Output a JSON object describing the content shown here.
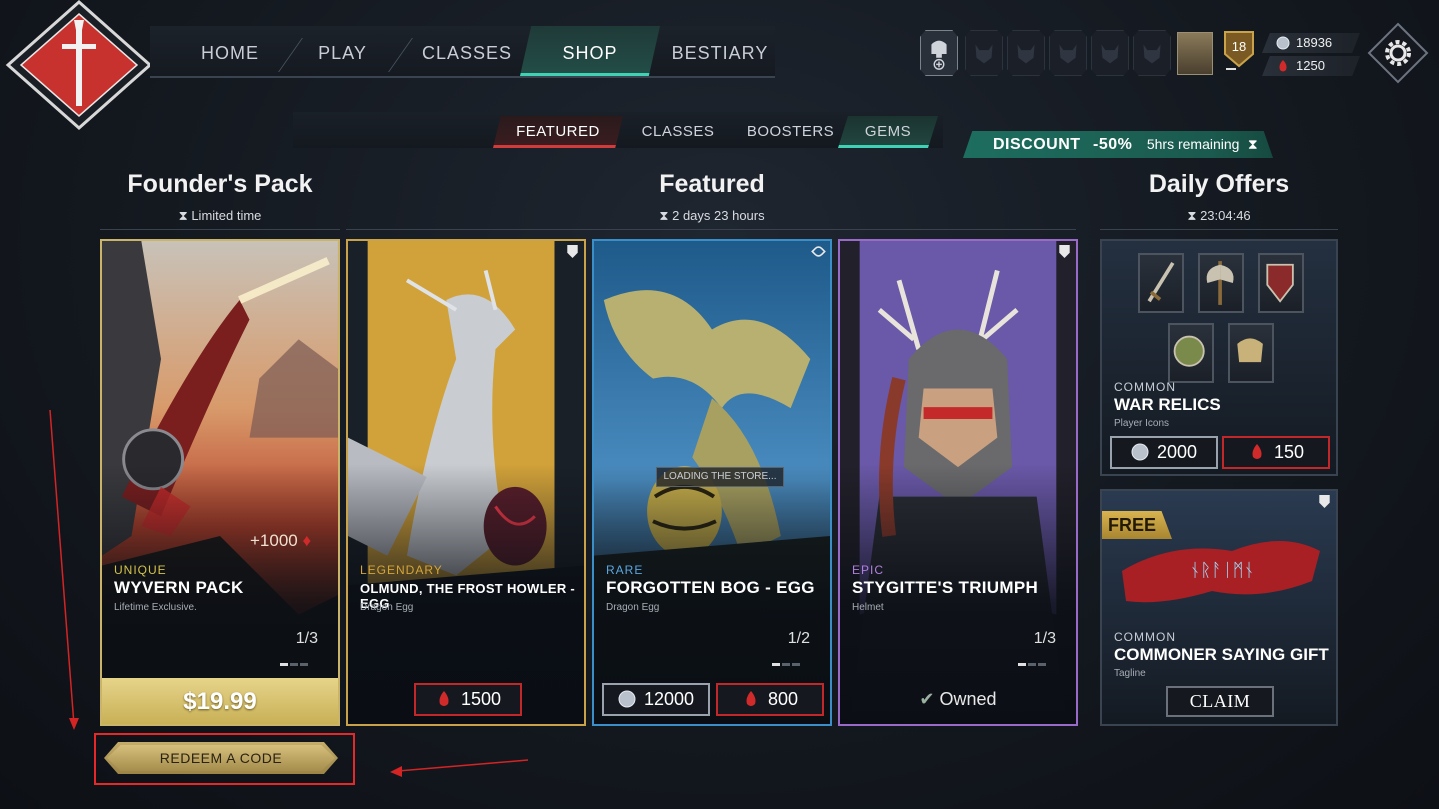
{
  "nav": {
    "items": [
      {
        "label": "HOME",
        "active": false
      },
      {
        "label": "PLAY",
        "active": false
      },
      {
        "label": "CLASSES",
        "active": false
      },
      {
        "label": "SHOP",
        "active": true
      },
      {
        "label": "BESTIARY",
        "active": false
      }
    ]
  },
  "player": {
    "level": "18",
    "silver": "18936",
    "gems": "1250"
  },
  "subtabs": [
    {
      "label": "FEATURED",
      "active": true
    },
    {
      "label": "CLASSES",
      "active": false
    },
    {
      "label": "BOOSTERS",
      "active": false
    },
    {
      "label": "GEMS",
      "active": false
    }
  ],
  "discount": {
    "label": "DISCOUNT",
    "value": "-50%",
    "remaining": "5hrs remaining"
  },
  "sections": {
    "founders": {
      "title": "Founder's Pack",
      "timer": "Limited time"
    },
    "featured": {
      "title": "Featured",
      "timer": "2 days 23 hours"
    },
    "daily": {
      "title": "Daily Offers",
      "timer": "23:04:46"
    }
  },
  "cards": [
    {
      "rarity": "UNIQUE",
      "name": "WYVERN PACK",
      "type": "Lifetime Exclusive.",
      "pager": "1/3",
      "bonus": "+1000",
      "price": "$19.99",
      "rarity_color": "#d4c34a"
    },
    {
      "rarity": "LEGENDARY",
      "name": "OLMUND, THE FROST HOWLER - EGG",
      "type": "Dragon Egg",
      "gem_price": "1500",
      "rarity_color": "#d4a53a"
    },
    {
      "rarity": "RARE",
      "name": "FORGOTTEN BOG - EGG",
      "type": "Dragon Egg",
      "pager": "1/2",
      "silver_price": "12000",
      "gem_price": "800",
      "overlay": "LOADING THE STORE...",
      "rarity_color": "#5aa7e0"
    },
    {
      "rarity": "EPIC",
      "name": "STYGITTE'S TRIUMPH",
      "type": "Helmet",
      "pager": "1/3",
      "status": "Owned",
      "rarity_color": "#b080e0"
    }
  ],
  "daily_offers": [
    {
      "rarity": "COMMON",
      "name": "WAR RELICS",
      "type": "Player Icons",
      "silver_price": "2000",
      "gem_price": "150"
    },
    {
      "tag": "FREE",
      "rarity": "COMMON",
      "name": "COMMONER SAYING GIFT",
      "type": "Tagline",
      "action": "CLAIM",
      "banner_text": "ᚾᚱᚨᛁᛗᚾ"
    }
  ],
  "redeem": {
    "label": "REDEEM A CODE"
  },
  "colors": {
    "accent_teal": "#3fd2b4",
    "accent_red": "#d13b3b",
    "gold": "#c4ac6a"
  }
}
